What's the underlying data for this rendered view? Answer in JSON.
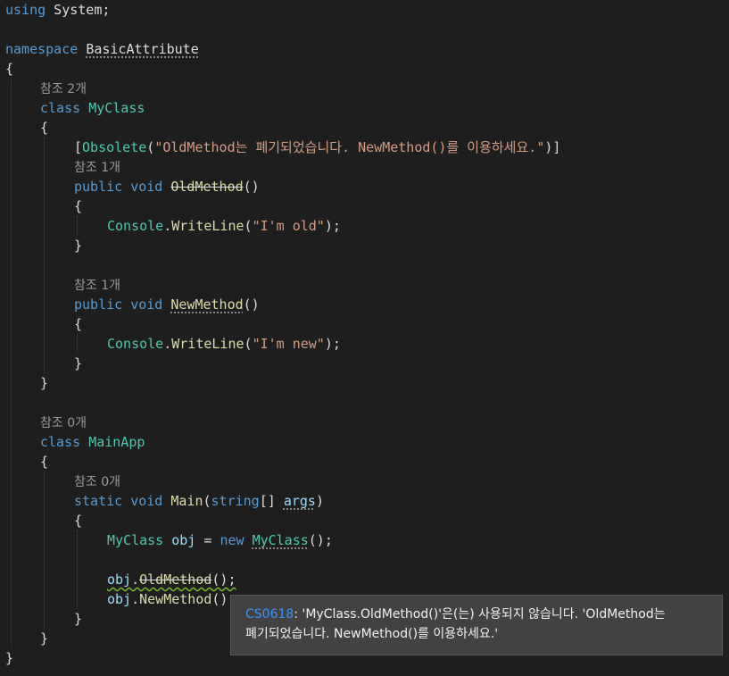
{
  "editor": {
    "lines": [
      {
        "l": 0,
        "t": 0,
        "s": [
          {
            "t": "using",
            "c": "kw"
          },
          {
            "t": " System;",
            "c": "pl"
          }
        ]
      },
      {
        "l": 0,
        "t": 44,
        "s": [
          {
            "t": "namespace",
            "c": "kw"
          },
          {
            "t": " ",
            "c": "pl"
          },
          {
            "t": "BasicAttribute",
            "c": "pl",
            "d": "dots"
          }
        ]
      },
      {
        "l": 0,
        "t": 66,
        "s": [
          {
            "t": "{",
            "c": "pl"
          }
        ]
      },
      {
        "l": 1,
        "t": 88,
        "lens": "참조 2개"
      },
      {
        "l": 1,
        "t": 110,
        "s": [
          {
            "t": "class",
            "c": "kw"
          },
          {
            "t": " ",
            "c": "pl"
          },
          {
            "t": "MyClass",
            "c": "ty"
          }
        ]
      },
      {
        "l": 1,
        "t": 132,
        "s": [
          {
            "t": "{",
            "c": "pl"
          }
        ]
      },
      {
        "l": 2,
        "t": 154,
        "s": [
          {
            "t": "[",
            "c": "pl"
          },
          {
            "t": "Obsolete",
            "c": "ty"
          },
          {
            "t": "(",
            "c": "pl"
          },
          {
            "t": "\"OldMethod는 폐기되었습니다. NewMethod()를 이용하세요.\"",
            "c": "st"
          },
          {
            "t": ")]",
            "c": "pl"
          }
        ]
      },
      {
        "l": 2,
        "t": 176,
        "lens": "참조 1개"
      },
      {
        "l": 2,
        "t": 198,
        "s": [
          {
            "t": "public",
            "c": "kw"
          },
          {
            "t": " ",
            "c": "pl"
          },
          {
            "t": "void",
            "c": "kw"
          },
          {
            "t": " ",
            "c": "pl"
          },
          {
            "t": "OldMethod",
            "c": "fn",
            "d": "strike"
          },
          {
            "t": "()",
            "c": "pl"
          }
        ]
      },
      {
        "l": 2,
        "t": 220,
        "s": [
          {
            "t": "{",
            "c": "pl"
          }
        ]
      },
      {
        "l": 3,
        "t": 242,
        "s": [
          {
            "t": "Console",
            "c": "ty"
          },
          {
            "t": ".",
            "c": "pl"
          },
          {
            "t": "WriteLine",
            "c": "fn"
          },
          {
            "t": "(",
            "c": "pl"
          },
          {
            "t": "\"I'm old\"",
            "c": "st"
          },
          {
            "t": ");",
            "c": "pl"
          }
        ]
      },
      {
        "l": 2,
        "t": 264,
        "s": [
          {
            "t": "}",
            "c": "pl"
          }
        ]
      },
      {
        "l": 2,
        "t": 308,
        "lens": "참조 1개"
      },
      {
        "l": 2,
        "t": 330,
        "s": [
          {
            "t": "public",
            "c": "kw"
          },
          {
            "t": " ",
            "c": "pl"
          },
          {
            "t": "void",
            "c": "kw"
          },
          {
            "t": " ",
            "c": "pl"
          },
          {
            "t": "NewMethod",
            "c": "fn",
            "d": "dots"
          },
          {
            "t": "()",
            "c": "pl"
          }
        ]
      },
      {
        "l": 2,
        "t": 352,
        "s": [
          {
            "t": "{",
            "c": "pl"
          }
        ]
      },
      {
        "l": 3,
        "t": 374,
        "s": [
          {
            "t": "Console",
            "c": "ty"
          },
          {
            "t": ".",
            "c": "pl"
          },
          {
            "t": "WriteLine",
            "c": "fn"
          },
          {
            "t": "(",
            "c": "pl"
          },
          {
            "t": "\"I'm new\"",
            "c": "st"
          },
          {
            "t": ");",
            "c": "pl"
          }
        ]
      },
      {
        "l": 2,
        "t": 396,
        "s": [
          {
            "t": "}",
            "c": "pl"
          }
        ]
      },
      {
        "l": 1,
        "t": 418,
        "s": [
          {
            "t": "}",
            "c": "pl"
          }
        ]
      },
      {
        "l": 1,
        "t": 462,
        "lens": "참조 0개"
      },
      {
        "l": 1,
        "t": 484,
        "s": [
          {
            "t": "class",
            "c": "kw"
          },
          {
            "t": " ",
            "c": "pl"
          },
          {
            "t": "MainApp",
            "c": "ty"
          }
        ]
      },
      {
        "l": 1,
        "t": 506,
        "s": [
          {
            "t": "{",
            "c": "pl"
          }
        ]
      },
      {
        "l": 2,
        "t": 528,
        "lens": "참조 0개"
      },
      {
        "l": 2,
        "t": 550,
        "s": [
          {
            "t": "static",
            "c": "kw"
          },
          {
            "t": " ",
            "c": "pl"
          },
          {
            "t": "void",
            "c": "kw"
          },
          {
            "t": " ",
            "c": "pl"
          },
          {
            "t": "Main",
            "c": "fn"
          },
          {
            "t": "(",
            "c": "pl"
          },
          {
            "t": "string",
            "c": "kw"
          },
          {
            "t": "[] ",
            "c": "pl"
          },
          {
            "t": "args",
            "c": "id",
            "d": "dots"
          },
          {
            "t": ")",
            "c": "pl"
          }
        ]
      },
      {
        "l": 2,
        "t": 572,
        "s": [
          {
            "t": "{",
            "c": "pl"
          }
        ]
      },
      {
        "l": 3,
        "t": 594,
        "s": [
          {
            "t": "MyClass",
            "c": "ty"
          },
          {
            "t": " ",
            "c": "pl"
          },
          {
            "t": "obj",
            "c": "id"
          },
          {
            "t": " = ",
            "c": "pl"
          },
          {
            "t": "new",
            "c": "kw"
          },
          {
            "t": " ",
            "c": "pl"
          },
          {
            "t": "MyClass",
            "c": "ty",
            "d": "dots"
          },
          {
            "t": "();",
            "c": "pl"
          }
        ]
      },
      {
        "l": 3,
        "t": 638,
        "s": [
          {
            "t": "obj",
            "c": "id"
          },
          {
            "t": ".",
            "c": "pl"
          },
          {
            "t": "OldMethod",
            "c": "fn",
            "d": "strike"
          },
          {
            "t": "();",
            "c": "pl"
          }
        ],
        "squig": true
      },
      {
        "l": 3,
        "t": 660,
        "s": [
          {
            "t": "obj",
            "c": "id"
          },
          {
            "t": ".",
            "c": "pl"
          },
          {
            "t": "NewMethod",
            "c": "fn"
          },
          {
            "t": "();",
            "c": "pl"
          }
        ]
      },
      {
        "l": 2,
        "t": 682,
        "s": [
          {
            "t": "}",
            "c": "pl"
          }
        ]
      },
      {
        "l": 1,
        "t": 704,
        "s": [
          {
            "t": "}",
            "c": "pl"
          }
        ]
      },
      {
        "l": 0,
        "t": 726,
        "s": [
          {
            "t": "}",
            "c": "pl"
          }
        ]
      }
    ]
  },
  "tooltip": {
    "code": "CS0618",
    "message_line1": ": 'MyClass.OldMethod()'은(는) 사용되지 않습니다. 'OldMethod는",
    "message_line2": "폐기되었습니다. NewMethod()를 이용하세요.'"
  },
  "colors": {
    "background": "#1e1e1e",
    "keyword": "#569cd6",
    "type": "#4ec9b0",
    "method": "#dcdcaa",
    "string": "#d69d85",
    "identifier": "#9cdcfe",
    "error_code": "#3794ff",
    "squiggle": "#79b62a"
  }
}
